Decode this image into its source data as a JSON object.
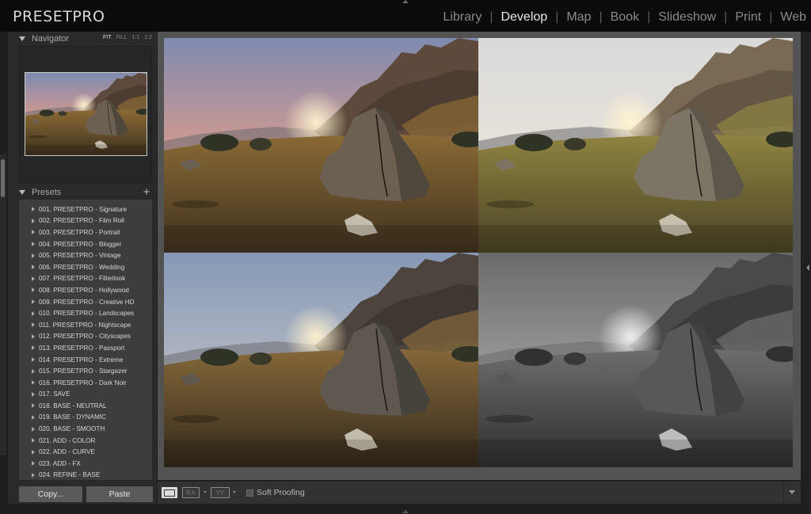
{
  "app": {
    "brand": "PRESETPRO"
  },
  "modules": [
    "Library",
    "Develop",
    "Map",
    "Book",
    "Slideshow",
    "Print",
    "Web"
  ],
  "active_module": "Develop",
  "navigator": {
    "title": "Navigator",
    "options": [
      "FIT",
      "FILL",
      "1:1",
      "1:2"
    ],
    "selected_option": "FIT"
  },
  "presets": {
    "title": "Presets",
    "add_label": "+",
    "items": [
      "001. PRESETPRO - Signature",
      "002. PRESETPRO - Film Roll",
      "003. PRESETPRO - Portrait",
      "004. PRESETPRO - Blogger",
      "005. PRESETPRO - Vintage",
      "006. PRESETPRO - Wedding",
      "007. PRESETPRO - Filterlook",
      "008. PRESETPRO - Hollywood",
      "009. PRESETPRO - Creative HD",
      "010. PRESETPRO - Landscapes",
      "011. PRESETPRO - Nightscape",
      "012. PRESETPRO - Cityscapes",
      "013. PRESETPRO - Passport",
      "014. PRESETPRO - Extreme",
      "015. PRESETPRO - Stargazer",
      "016. PRESETPRO - Dark Noir",
      "017. SAVE",
      "018. BASE - NEUTRAL",
      "019. BASE - DYNAMIC",
      "020. BASE - SMOOTH",
      "021. ADD - COLOR",
      "022. ADD - CURVE",
      "023. ADD - FX",
      "024. REFINE - BASE"
    ]
  },
  "buttons": {
    "copy": "Copy...",
    "paste": "Paste"
  },
  "toolbar": {
    "view_ra": "RA",
    "view_yy": "YY",
    "soft_proofing": "Soft Proofing",
    "soft_proofing_checked": false
  },
  "tiles": [
    {
      "name": "original-warm",
      "sky_top": "#7f8bb0",
      "sky_mid": "#d49a8f",
      "sky_low": "#f0b88a",
      "cliff": "#5e4a3c",
      "rock": "#6c6052",
      "field": "#8a6a35",
      "field_dark": "#3f3220",
      "grayscale": false
    },
    {
      "name": "preset-bright",
      "sky_top": "#dadada",
      "sky_mid": "#e6e2da",
      "sky_low": "#efe5d2",
      "cliff": "#7a6a55",
      "rock": "#7c7465",
      "field": "#8f8442",
      "field_dark": "#4a4326",
      "grayscale": false
    },
    {
      "name": "preset-cool",
      "sky_top": "#8598b5",
      "sky_mid": "#b2b7c3",
      "sky_low": "#e2c9a6",
      "cliff": "#4d443d",
      "rock": "#5e5850",
      "field": "#85683a",
      "field_dark": "#33291c",
      "grayscale": false
    },
    {
      "name": "preset-bw",
      "sky_top": "#6a6a6a",
      "sky_mid": "#9a9a9a",
      "sky_low": "#c8c8c8",
      "cliff": "#4a4a4a",
      "rock": "#585858",
      "field": "#6d6d6d",
      "field_dark": "#2e2e2e",
      "grayscale": true
    }
  ]
}
